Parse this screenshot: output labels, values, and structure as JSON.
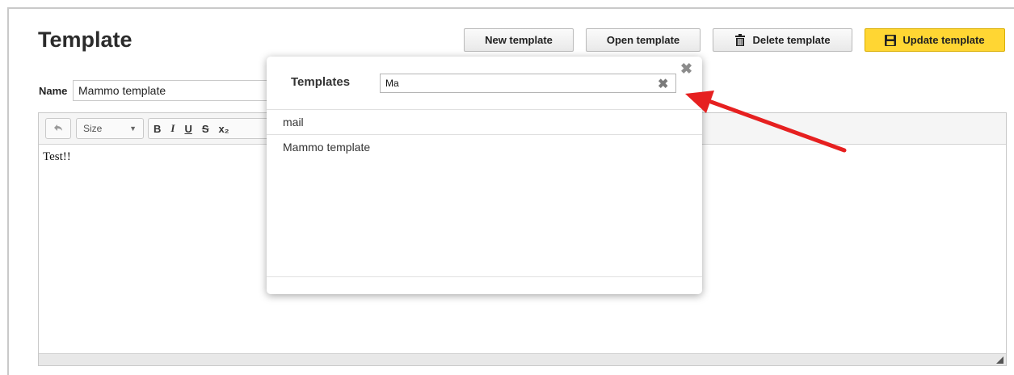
{
  "page": {
    "title": "Template"
  },
  "toolbar": {
    "new_label": "New template",
    "open_label": "Open template",
    "delete_label": "Delete template",
    "update_label": "Update template"
  },
  "form": {
    "name_label": "Name",
    "name_value": "Mammo template"
  },
  "editor": {
    "undo_icon": "undo-icon",
    "size_label": "Size",
    "format_buttons": [
      "B",
      "I",
      "U",
      "S",
      "x₂"
    ],
    "content": "Test!!"
  },
  "modal": {
    "title": "Templates",
    "search_value": "Ma",
    "items": [
      "mail",
      "Mammo template"
    ]
  },
  "colors": {
    "accent": "#ffd633",
    "annotation_arrow": "#e62020"
  }
}
